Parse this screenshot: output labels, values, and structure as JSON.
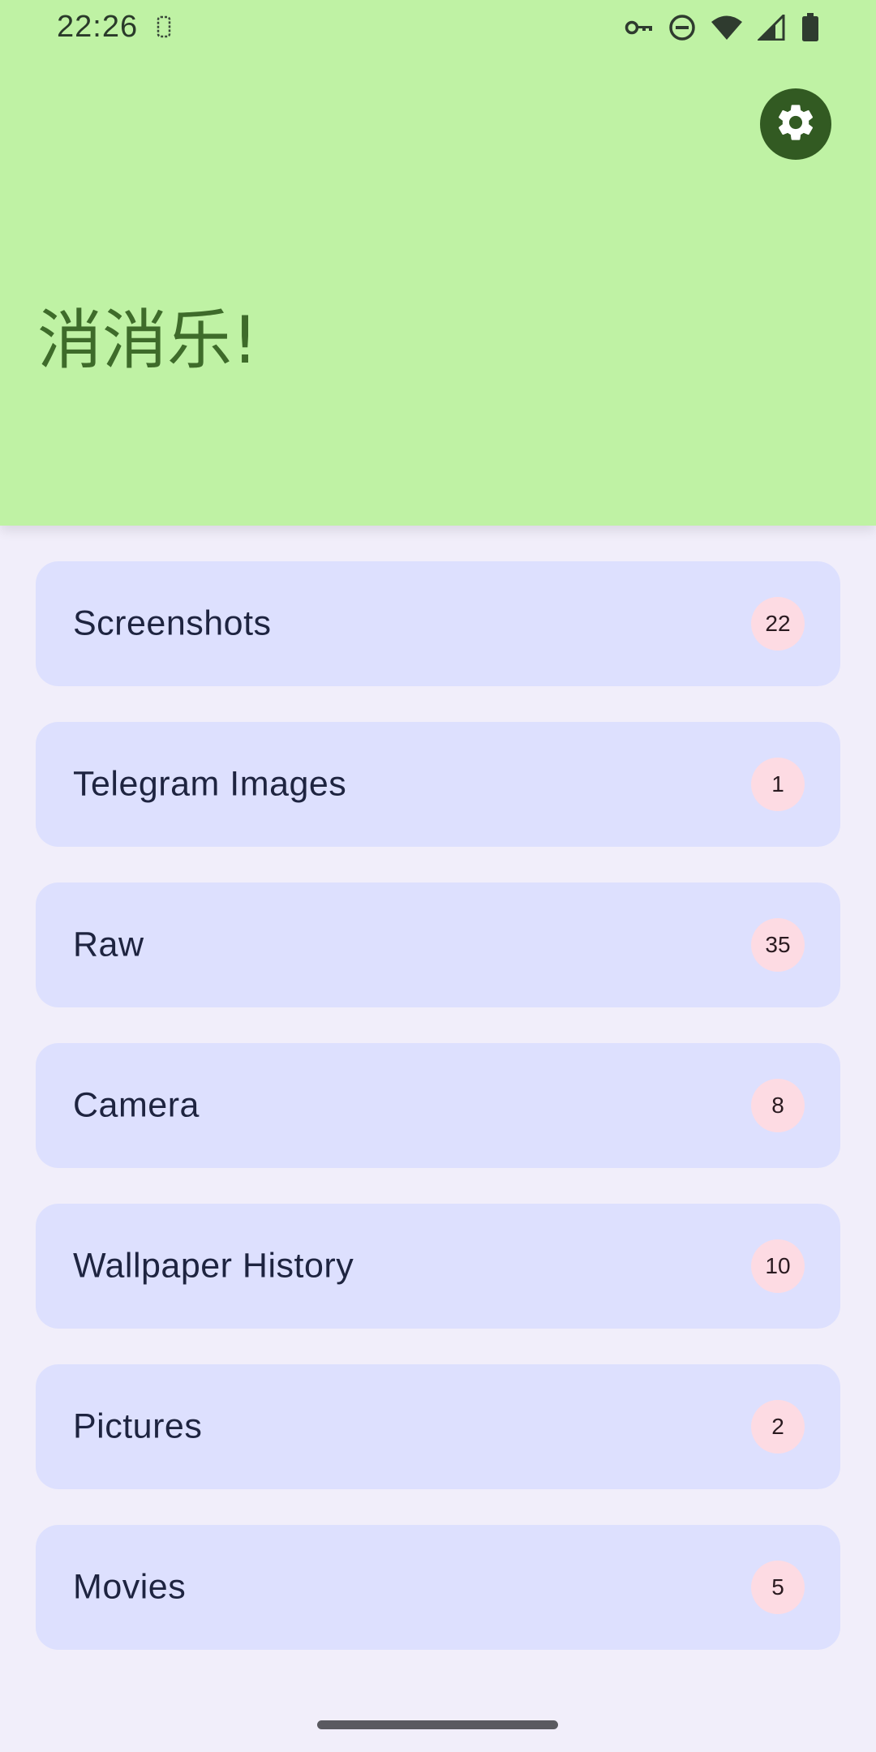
{
  "status_bar": {
    "time": "22:26"
  },
  "header": {
    "title": "消消乐!",
    "settings_icon": "gear-icon"
  },
  "albums": [
    {
      "name": "Screenshots",
      "count": "22"
    },
    {
      "name": "Telegram Images",
      "count": "1"
    },
    {
      "name": "Raw",
      "count": "35"
    },
    {
      "name": "Camera",
      "count": "8"
    },
    {
      "name": "Wallpaper History",
      "count": "10"
    },
    {
      "name": "Pictures",
      "count": "2"
    },
    {
      "name": "Movies",
      "count": "5"
    }
  ],
  "colors": {
    "header_bg": "#bff2a4",
    "title": "#3e6b2a",
    "settings_bg": "#325a22",
    "card_bg": "#dde0fe",
    "badge_bg": "#fddbe3",
    "page_bg": "#f1eefa"
  }
}
